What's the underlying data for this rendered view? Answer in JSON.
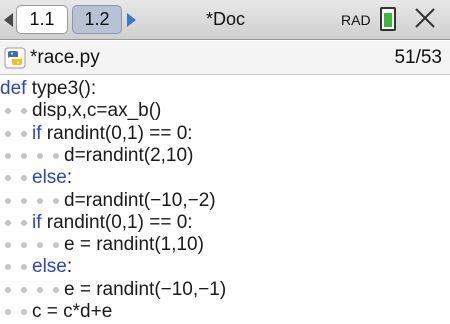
{
  "topbar": {
    "tabs": [
      {
        "label": "1.1"
      },
      {
        "label": "1.2"
      }
    ],
    "doc_title": "*Doc",
    "angle_mode": "RAD"
  },
  "file": {
    "name": "*race.py",
    "line_info": "51/53"
  },
  "code_lines": [
    {
      "indent": 0,
      "parts": [
        {
          "t": "def",
          "k": "kw"
        },
        {
          "t": " type3():",
          "k": ""
        }
      ]
    },
    {
      "indent": 2,
      "parts": [
        {
          "t": "disp,x,c=ax_b()",
          "k": ""
        }
      ]
    },
    {
      "indent": 2,
      "parts": [
        {
          "t": "if",
          "k": "kw"
        },
        {
          "t": " randint(0,1) == 0:",
          "k": ""
        }
      ]
    },
    {
      "indent": 4,
      "parts": [
        {
          "t": "d=randint(2,10)",
          "k": ""
        }
      ]
    },
    {
      "indent": 2,
      "parts": [
        {
          "t": "else",
          "k": "kw"
        },
        {
          "t": ":",
          "k": ""
        }
      ]
    },
    {
      "indent": 4,
      "parts": [
        {
          "t": "d=randint(−10,−2)",
          "k": ""
        }
      ]
    },
    {
      "indent": 2,
      "parts": [
        {
          "t": "if",
          "k": "kw"
        },
        {
          "t": " randint(0,1) == 0:",
          "k": ""
        }
      ]
    },
    {
      "indent": 4,
      "parts": [
        {
          "t": "e = randint(1,10)",
          "k": ""
        }
      ]
    },
    {
      "indent": 2,
      "parts": [
        {
          "t": "else",
          "k": "kw"
        },
        {
          "t": ":",
          "k": ""
        }
      ]
    },
    {
      "indent": 4,
      "parts": [
        {
          "t": "e = randint(−10,−1)",
          "k": ""
        }
      ]
    },
    {
      "indent": 2,
      "parts": [
        {
          "t": "c = c*d+e",
          "k": ""
        }
      ]
    }
  ],
  "colors": {
    "keyword": "#2b45c8",
    "battery": "#3db83d",
    "active_tab": "#ffffff",
    "inactive_tab": "#b7c3d4"
  },
  "icons": {
    "python_file": "python-logo-icon",
    "close": "close-icon",
    "battery": "battery-icon"
  }
}
